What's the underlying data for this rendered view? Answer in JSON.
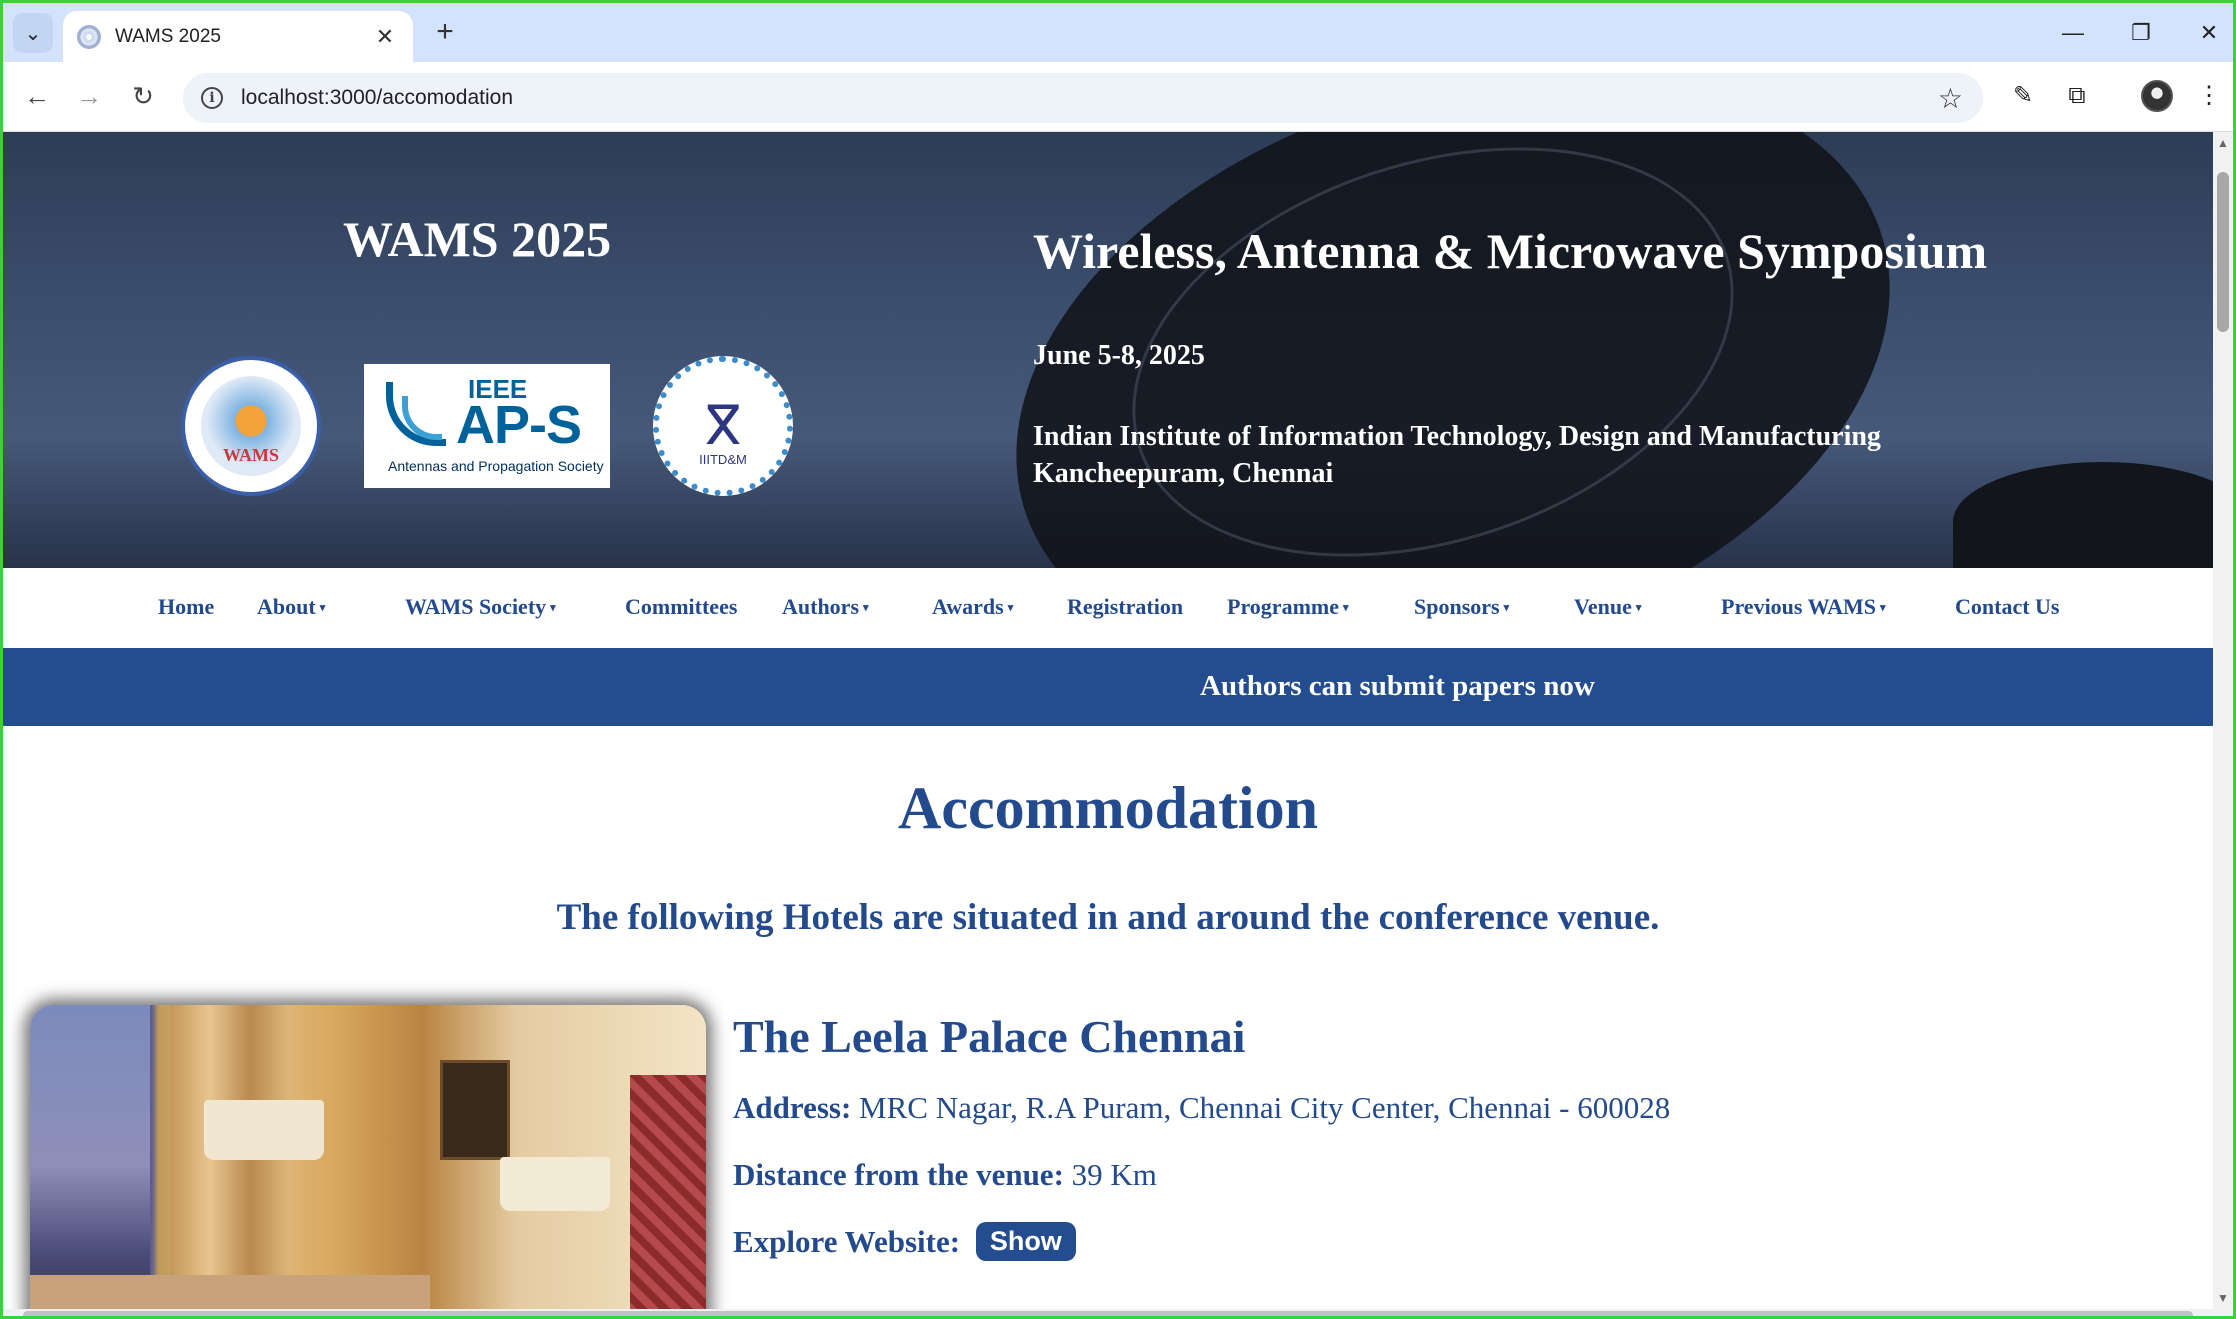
{
  "browser": {
    "tab_title": "WAMS 2025",
    "url": "localhost:3000/accomodation",
    "new_tab_symbol": "+",
    "tab_close_symbol": "✕"
  },
  "hero": {
    "site_title": "WAMS 2025",
    "symposium_name": "Wireless, Antenna & Microwave Symposium",
    "dates": "June 5-8, 2025",
    "institute_line1": "Indian Institute of Information Technology, Design and Manufacturing",
    "institute_line2": "Kancheepuram, Chennai",
    "logos": {
      "wams_text": "WAMS",
      "ieee_text": "IEEE",
      "aps_text": "AP-S",
      "aps_subtitle": "Antennas and Propagation Society",
      "iiitdm_text": "IIITD&M"
    }
  },
  "nav": {
    "items": [
      {
        "label": "Home",
        "dropdown": false
      },
      {
        "label": "About",
        "dropdown": true
      },
      {
        "label": "WAMS Society",
        "dropdown": true
      },
      {
        "label": "Committees",
        "dropdown": false
      },
      {
        "label": "Authors",
        "dropdown": true
      },
      {
        "label": "Awards",
        "dropdown": true
      },
      {
        "label": "Registration",
        "dropdown": false
      },
      {
        "label": "Programme",
        "dropdown": true
      },
      {
        "label": "Sponsors",
        "dropdown": true
      },
      {
        "label": "Venue",
        "dropdown": true
      },
      {
        "label": "Previous WAMS",
        "dropdown": true
      },
      {
        "label": "Contact Us",
        "dropdown": false
      }
    ],
    "caret": "▾"
  },
  "announcement": "Authors can submit papers now",
  "page": {
    "heading": "Accommodation",
    "intro": "The following Hotels are situated in and around the conference venue."
  },
  "hotels": [
    {
      "name": "The Leela Palace Chennai",
      "address_label": "Address:",
      "address": "MRC Nagar, R.A Puram, Chennai City Center, Chennai - 600028",
      "distance_label": "Distance from the venue:",
      "distance": "39 Km",
      "website_label": "Explore Website:",
      "website_button": "Show"
    }
  ],
  "colors": {
    "brand_blue": "#234a8c",
    "announce_bg": "#244d8f",
    "window_border": "#3ad13a"
  }
}
